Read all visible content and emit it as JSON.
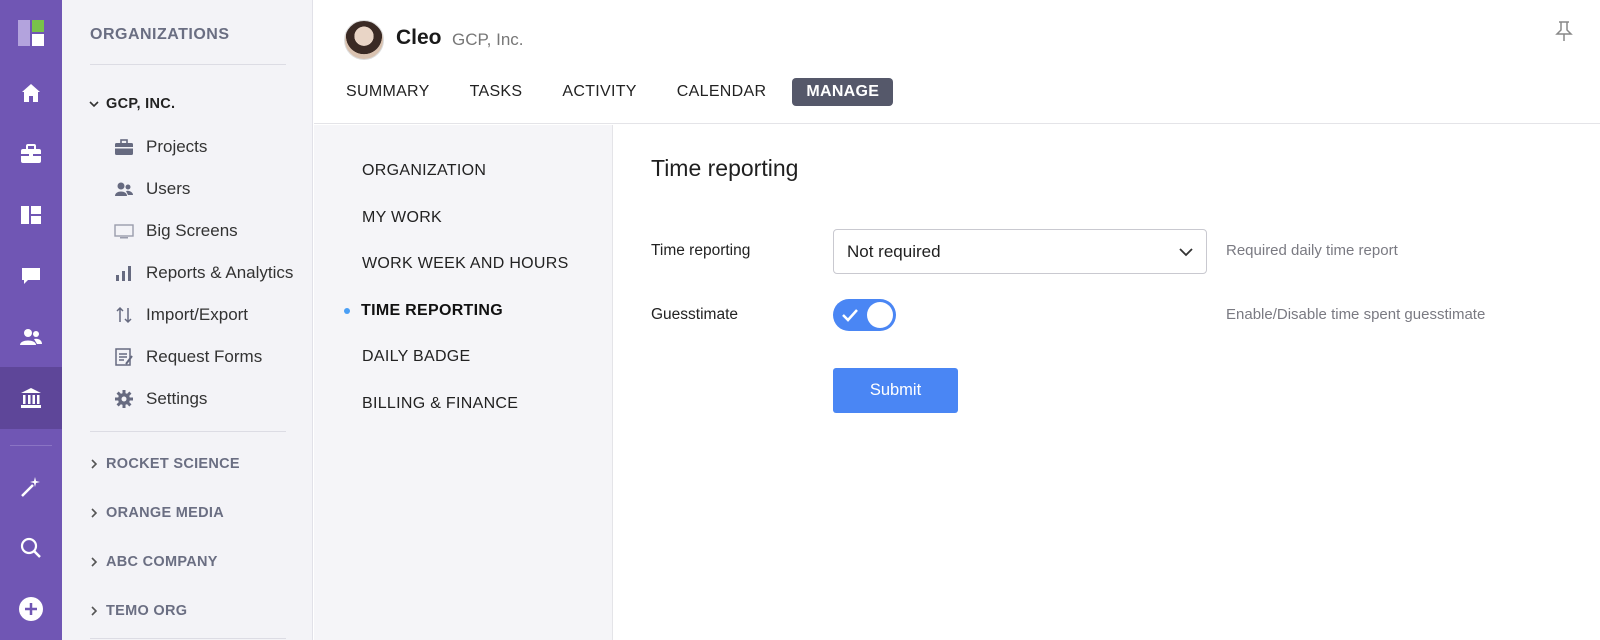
{
  "rail": {
    "icons": [
      "logo-icon",
      "home-icon",
      "briefcase-icon",
      "dashboard-icon",
      "chat-icon",
      "people-icon",
      "bank-icon",
      "magic-wand-icon",
      "search-icon",
      "add-icon"
    ]
  },
  "orgs": {
    "title": "ORGANIZATIONS",
    "expanded": "GCP, INC.",
    "sub_items": [
      {
        "label": "Projects",
        "icon": "briefcase-icon"
      },
      {
        "label": "Users",
        "icon": "users-icon"
      },
      {
        "label": "Big Screens",
        "icon": "screen-icon"
      },
      {
        "label": "Reports & Analytics",
        "icon": "bar-chart-icon"
      },
      {
        "label": "Import/Export",
        "icon": "import-export-icon"
      },
      {
        "label": "Request Forms",
        "icon": "form-icon"
      },
      {
        "label": "Settings",
        "icon": "gear-icon"
      }
    ],
    "collapsed": [
      "ROCKET SCIENCE",
      "ORANGE MEDIA",
      "ABC COMPANY",
      "TEMO ORG"
    ]
  },
  "header": {
    "user_name": "Cleo",
    "user_org": "GCP, Inc.",
    "tabs": [
      "SUMMARY",
      "TASKS",
      "ACTIVITY",
      "CALENDAR",
      "MANAGE"
    ],
    "active_tab": "MANAGE"
  },
  "submenu": {
    "items": [
      "ORGANIZATION",
      "MY WORK",
      "WORK WEEK AND HOURS",
      "TIME REPORTING",
      "DAILY BADGE",
      "BILLING & FINANCE"
    ],
    "active": "TIME REPORTING"
  },
  "content": {
    "title": "Time reporting",
    "time_reporting_label": "Time reporting",
    "time_reporting_value": "Not required",
    "time_reporting_hint": "Required daily time report",
    "guesstimate_label": "Guesstimate",
    "guesstimate_enabled": true,
    "guesstimate_hint": "Enable/Disable time spent guesstimate",
    "submit_label": "Submit"
  },
  "colors": {
    "rail": "#7056b4",
    "accent": "#4a86f4",
    "active_tab": "#55586a"
  }
}
